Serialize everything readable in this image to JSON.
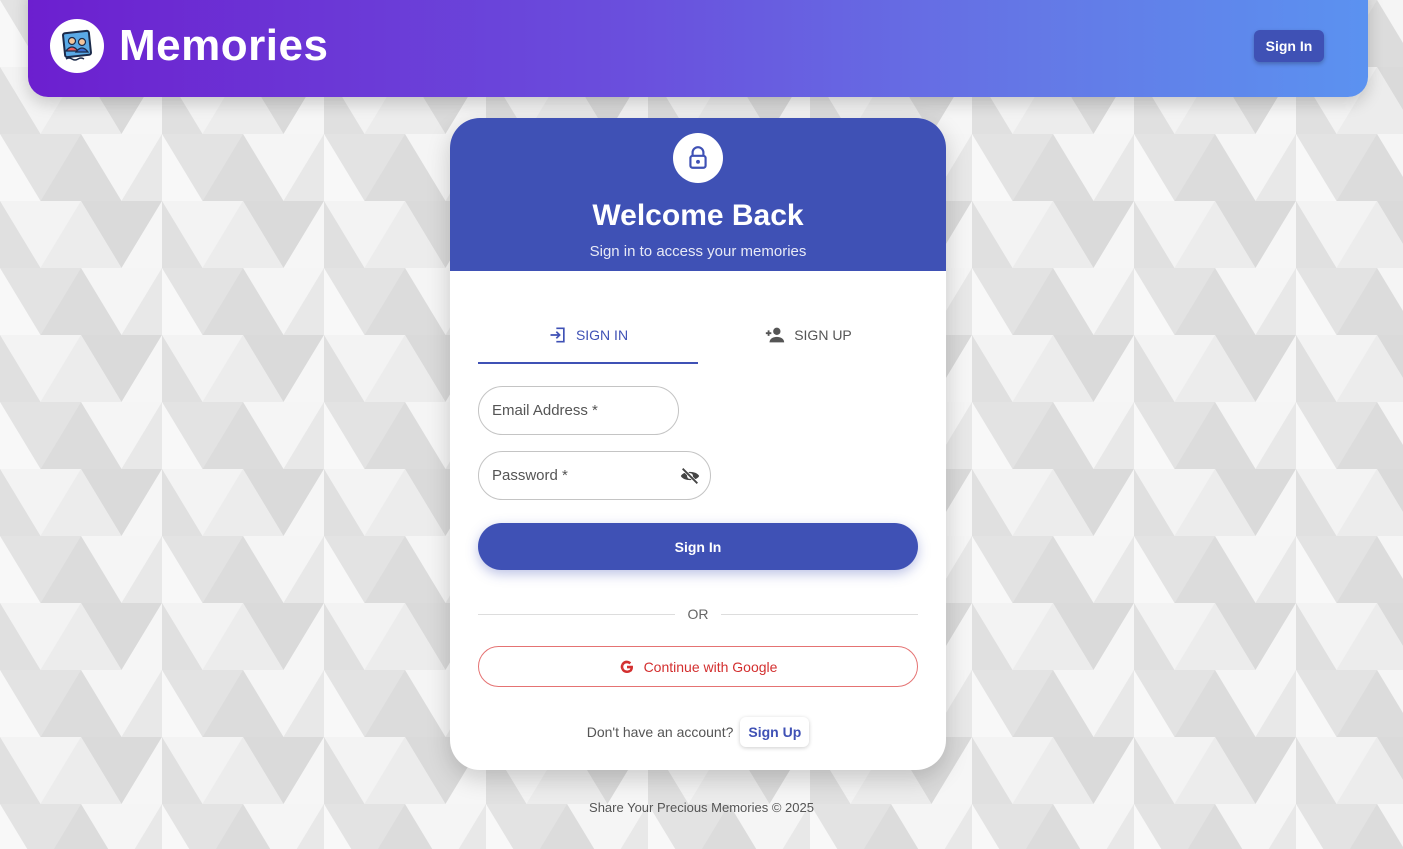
{
  "header": {
    "brand_title": "Memories",
    "signin_label": "Sign In",
    "logo_icon": "photo-frame-icon",
    "gradient_start": "#6c1fcf",
    "gradient_end": "#5b92f0"
  },
  "card": {
    "lock_icon": "lock-icon",
    "title": "Welcome Back",
    "subtitle": "Sign in to access your memories",
    "accent_color": "#3f51b5",
    "tabs": [
      {
        "label": "SIGN IN",
        "icon": "login-icon",
        "active": true
      },
      {
        "label": "SIGN UP",
        "icon": "person-add-icon",
        "active": false
      }
    ],
    "email_label": "Email Address *",
    "password_label": "Password *",
    "password_toggle_icon": "eye-off-icon",
    "submit_label": "Sign In",
    "divider_text": "OR",
    "google_label": "Continue with Google",
    "google_icon": "google-icon",
    "account_prompt": "Don't have an account?",
    "signup_link": "Sign Up"
  },
  "footer": {
    "text": "Share Your Precious Memories © 2025"
  }
}
